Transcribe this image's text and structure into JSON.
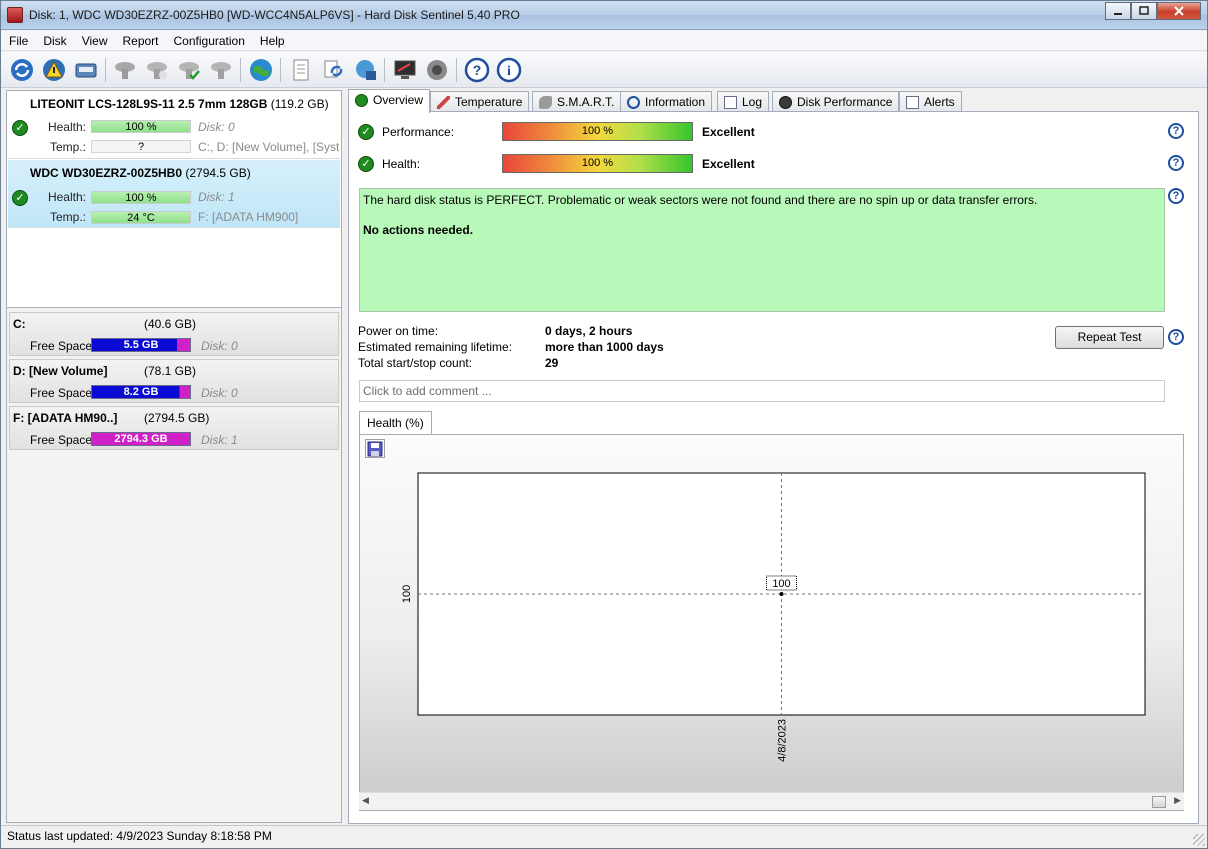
{
  "window": {
    "title": "Disk: 1, WDC WD30EZRZ-00Z5HB0 [WD-WCC4N5ALP6VS]  -  Hard Disk Sentinel 5.40 PRO",
    "minimize": "0",
    "maximize": "1",
    "close": "X"
  },
  "menu": {
    "file": "File",
    "disk": "Disk",
    "view": "View",
    "report": "Report",
    "configuration": "Configuration",
    "help": "Help"
  },
  "toolbar": {
    "icons": [
      "refresh-icon",
      "warning-icon",
      "drive-icon",
      "disk-gray-icon",
      "disk-gray2-icon",
      "disk-check-icon",
      "disk-gray3-icon",
      "globe-icon",
      "report-icon",
      "refresh-network-icon",
      "network-icon",
      "monitor-icon",
      "speaker-icon",
      "help-icon",
      "info-icon"
    ]
  },
  "disks": [
    {
      "name": "LITEONIT LCS-128L9S-11 2.5 7mm 128GB",
      "size": "(119.2 GB)",
      "health_label": "Health:",
      "health": "100 %",
      "health_pct": 100,
      "disk_no": "Disk: 0",
      "temp_label": "Temp.:",
      "temp": "?",
      "volumes": "C:, D: [New Volume],  [Syst",
      "selected": false
    },
    {
      "name": "WDC WD30EZRZ-00Z5HB0",
      "size": "(2794.5 GB)",
      "health_label": "Health:",
      "health": "100 %",
      "health_pct": 100,
      "disk_no": "Disk: 1",
      "temp_label": "Temp.:",
      "temp": "24 °C",
      "volumes": "F: [ADATA HM900]",
      "selected": true
    }
  ],
  "volumes": [
    {
      "name": "C:",
      "size": "(40.6 GB)",
      "label": "Free Space",
      "free": "5.5 GB",
      "free_pct": 13.5,
      "bar_color": "#0a0ad4",
      "used_color": "#d020c8",
      "disk_no": "Disk: 0"
    },
    {
      "name": "D: [New Volume]",
      "size": "(78.1 GB)",
      "label": "Free Space",
      "free": "8.2 GB",
      "free_pct": 10.5,
      "bar_color": "#0a0ad4",
      "used_color": "#d020c8",
      "disk_no": "Disk: 0"
    },
    {
      "name": "F: [ADATA HM90..]",
      "size": "(2794.5 GB)",
      "label": "Free Space",
      "free": "2794.3 GB",
      "free_pct": 99.9,
      "bar_color": "#d020c8",
      "used_color": "#d020c8",
      "disk_no": "Disk: 1"
    }
  ],
  "tabs": [
    "Overview",
    "Temperature",
    "S.M.A.R.T.",
    "Information",
    "Log",
    "Disk Performance",
    "Alerts"
  ],
  "overview": {
    "performance_label": "Performance:",
    "performance_value": "100 %",
    "performance_pct": 100,
    "performance_rating": "Excellent",
    "health_label": "Health:",
    "health_value": "100 %",
    "health_pct": 100,
    "health_rating": "Excellent",
    "status_text": "The hard disk status is PERFECT. Problematic or weak sectors were not found and there are no spin up or data transfer errors.",
    "status_action": "No actions needed.",
    "status_color": "#b8f8b8",
    "power_on_label": "Power on time:",
    "power_on_value": "0 days, 2 hours",
    "lifetime_label": "Estimated remaining lifetime:",
    "lifetime_value": "more than 1000 days",
    "startstop_label": "Total start/stop count:",
    "startstop_value": "29",
    "repeat_button": "Repeat Test",
    "comment_placeholder": "Click to add comment ..."
  },
  "chart_tab": "Health (%)",
  "chart_data": {
    "type": "line",
    "title": "",
    "xlabel": "",
    "ylabel": "",
    "x": [
      "4/8/2023"
    ],
    "series": [
      {
        "values": [
          100
        ]
      }
    ],
    "y_tick": "100",
    "data_label": "100",
    "grid": true
  },
  "status_bar": "Status last updated: 4/9/2023 Sunday 8:18:58 PM"
}
